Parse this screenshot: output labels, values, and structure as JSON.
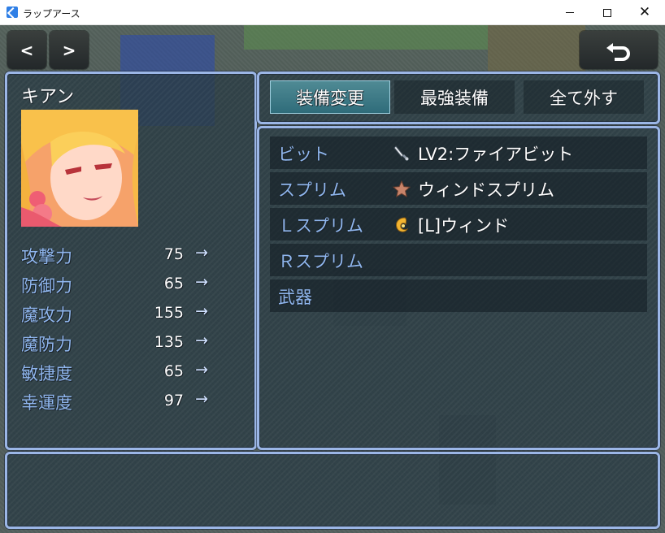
{
  "window": {
    "title": "ラップアース",
    "minimize": "—",
    "maximize": "☐",
    "close": "✕"
  },
  "nav": {
    "prev_label": "<",
    "next_label": ">",
    "back_icon": "return-arrow-icon"
  },
  "actor": {
    "name": "キアン",
    "stats": [
      {
        "label": "攻撃力",
        "value": "75",
        "arrow": "→"
      },
      {
        "label": "防御力",
        "value": "65",
        "arrow": "→"
      },
      {
        "label": "魔攻力",
        "value": "155",
        "arrow": "→"
      },
      {
        "label": "魔防力",
        "value": "135",
        "arrow": "→"
      },
      {
        "label": "敏捷度",
        "value": "65",
        "arrow": "→"
      },
      {
        "label": "幸運度",
        "value": "97",
        "arrow": "→"
      }
    ]
  },
  "commands": [
    {
      "label": "装備変更",
      "selected": true
    },
    {
      "label": "最強装備",
      "selected": false
    },
    {
      "label": "全て外す",
      "selected": false
    }
  ],
  "slots": [
    {
      "name": "ビット",
      "item": "LV2:ファイアビット",
      "icon": "bit-dagger-icon"
    },
    {
      "name": "スプリム",
      "item": "ウィンドスプリム",
      "icon": "star-icon"
    },
    {
      "name": "Ｌスプリム",
      "item": "[L]ウィンド",
      "icon": "wind-swirl-icon"
    },
    {
      "name": "Ｒスプリム",
      "item": "",
      "icon": ""
    },
    {
      "name": "武器",
      "item": "",
      "icon": ""
    }
  ],
  "help": {
    "text": ""
  },
  "colors": {
    "window_frame": "#9bb6e6",
    "system_text": "#8fb6ee",
    "selected_command": "#2f6c7a"
  }
}
